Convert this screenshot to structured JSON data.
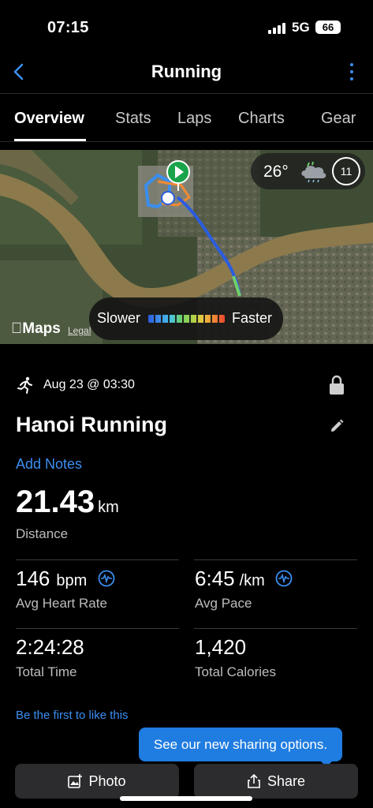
{
  "status": {
    "time": "07:15",
    "network": "5G",
    "battery": "66"
  },
  "nav": {
    "title": "Running"
  },
  "tabs": [
    "Overview",
    "Stats",
    "Laps",
    "Charts",
    "Gear"
  ],
  "map": {
    "temperature": "26°",
    "clock_value": "11",
    "attribution": "Maps",
    "legal": "Legal",
    "legend_slower": "Slower",
    "legend_faster": "Faster"
  },
  "activity": {
    "date": "Aug 23 @ 03:30",
    "title": "Hanoi Running",
    "add_notes": "Add Notes",
    "distance_value": "21.43",
    "distance_unit": "km",
    "distance_label": "Distance"
  },
  "stats": {
    "heart_rate_value": "146",
    "heart_rate_unit": "bpm",
    "heart_rate_label": "Avg Heart Rate",
    "pace_value": "6:45",
    "pace_unit": "/km",
    "pace_label": "Avg Pace",
    "time_value": "2:24:28",
    "time_label": "Total Time",
    "calories_value": "1,420",
    "calories_label": "Total Calories"
  },
  "social": {
    "like_text": "Be the first to like this"
  },
  "tooltip": {
    "text": "See our new sharing options."
  },
  "buttons": {
    "photo": "Photo",
    "share": "Share"
  },
  "colors": {
    "accent": "#3b8ef0",
    "tooltip": "#1f7ce0",
    "background": "#000000",
    "button": "#2c2c2e"
  }
}
